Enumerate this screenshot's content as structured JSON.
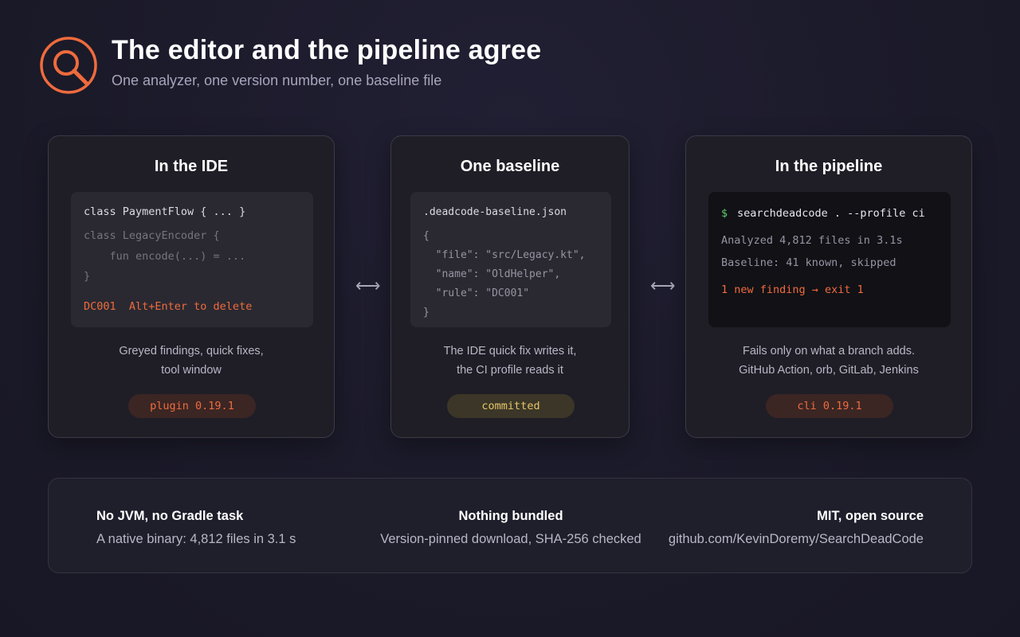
{
  "header": {
    "title": "The editor and the pipeline agree",
    "subtitle": "One analyzer, one version number, one baseline file",
    "logo_icon": "magnifier-icon"
  },
  "colors": {
    "accent": "#ef6b3d",
    "background": "#1b1a29",
    "card": "#1f1e26",
    "code_block": "#2a2931",
    "terminal": "#111116",
    "yellow": "#e6c56a",
    "green": "#5ecf6a"
  },
  "arrows": {
    "symbol": "⟷"
  },
  "cards": {
    "ide": {
      "title": "In the IDE",
      "code": {
        "line1": "class PaymentFlow { ... }",
        "line2": "class LegacyEncoder {",
        "line3": "    fun encode(...) = ...",
        "line4": "}",
        "hint": "DC001  Alt+Enter to delete"
      },
      "desc_line1": "Greyed findings, quick fixes,",
      "desc_line2": "tool window",
      "pill": "plugin 0.19.1"
    },
    "baseline": {
      "title": "One baseline",
      "code": {
        "filename": ".deadcode-baseline.json",
        "line1": "{",
        "line2": "  \"file\": \"src/Legacy.kt\",",
        "line3": "  \"name\": \"OldHelper\",",
        "line4": "  \"rule\": \"DC001\"",
        "line5": "}"
      },
      "desc_line1": "The IDE quick fix writes it,",
      "desc_line2": "the CI profile reads it",
      "pill": "committed"
    },
    "pipeline": {
      "title": "In the pipeline",
      "terminal": {
        "prompt": "$",
        "command": "searchdeadcode . --profile ci",
        "line1": "Analyzed 4,812 files in 3.1s",
        "line2": "Baseline: 41 known, skipped",
        "result": "1 new finding → exit 1"
      },
      "desc_line1": "Fails only on what a branch adds.",
      "desc_line2": "GitHub Action, orb, GitLab, Jenkins",
      "pill": "cli 0.19.1"
    }
  },
  "footer": {
    "col1": {
      "heading": "No JVM, no Gradle task",
      "text": "A native binary: 4,812 files in 3.1 s"
    },
    "col2": {
      "heading": "Nothing bundled",
      "text": "Version-pinned download, SHA-256 checked"
    },
    "col3": {
      "heading": "MIT, open source",
      "text": "github.com/KevinDoremy/SearchDeadCode"
    }
  }
}
